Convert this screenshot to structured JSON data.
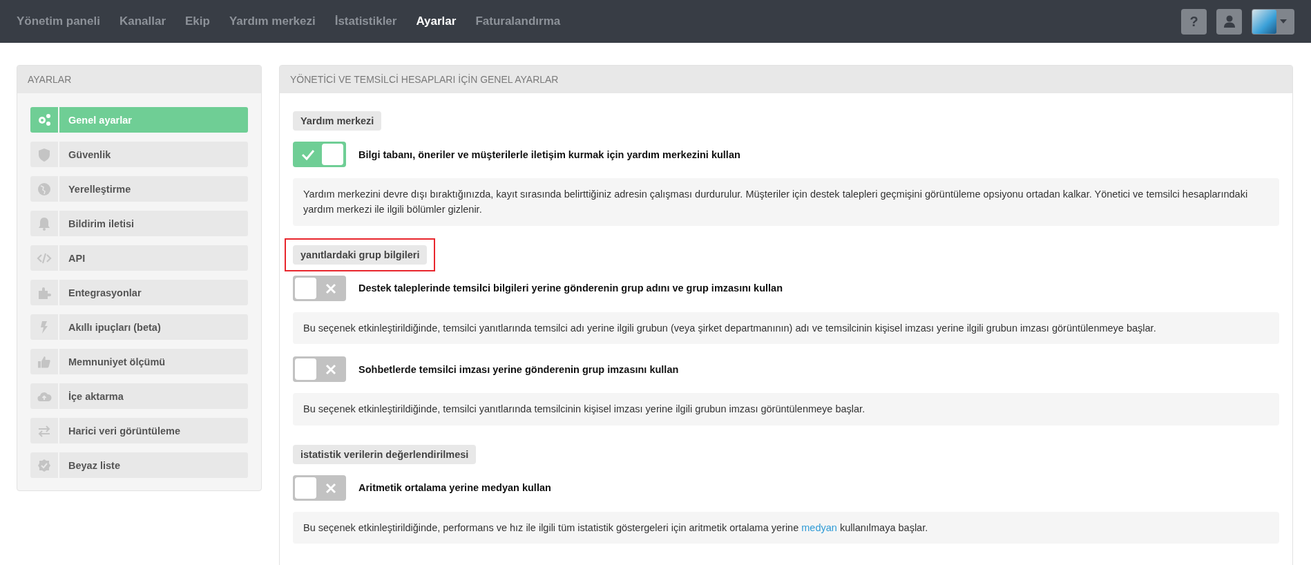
{
  "top_nav": {
    "items": [
      {
        "label": "Yönetim paneli",
        "selected": false
      },
      {
        "label": "Kanallar",
        "selected": false
      },
      {
        "label": "Ekip",
        "selected": false
      },
      {
        "label": "Yardım merkezi",
        "selected": false
      },
      {
        "label": "İstatistikler",
        "selected": false
      },
      {
        "label": "Ayarlar",
        "selected": true
      },
      {
        "label": "Faturalandırma",
        "selected": false
      }
    ],
    "help_button": "?"
  },
  "sidebar": {
    "title": "AYARLAR",
    "items": [
      {
        "label": "Genel ayarlar",
        "selected": true
      },
      {
        "label": "Güvenlik",
        "selected": false
      },
      {
        "label": "Yerelleştirme",
        "selected": false
      },
      {
        "label": "Bildirim iletisi",
        "selected": false
      },
      {
        "label": "API",
        "selected": false
      },
      {
        "label": "Entegrasyonlar",
        "selected": false
      },
      {
        "label": "Akıllı ipuçları (beta)",
        "selected": false
      },
      {
        "label": "Memnuniyet ölçümü",
        "selected": false
      },
      {
        "label": "İçe aktarma",
        "selected": false
      },
      {
        "label": "Harici veri görüntüleme",
        "selected": false
      },
      {
        "label": "Beyaz liste",
        "selected": false
      }
    ]
  },
  "main": {
    "title": "YÖNETİCİ VE TEMSİLCİ HESAPLARI İÇİN GENEL AYARLAR",
    "sections": [
      {
        "heading": "Yardım merkezi",
        "highlighted": false,
        "settings": [
          {
            "label": "Bilgi tabanı, öneriler ve müşterilerle iletişim kurmak için yardım merkezini kullan",
            "on": true,
            "description": [
              {
                "kind": "text",
                "text": "Yardım merkezini devre dışı bıraktığınızda, kayıt sırasında belirttiğiniz adresin çalışması durdurulur. Müşteriler için destek talepleri geçmişini görüntüleme opsiyonu ortadan kalkar. Yönetici ve temsilci hesaplarındaki yardım merkezi ile ilgili bölümler gizlenir."
              }
            ]
          }
        ]
      },
      {
        "heading": "yanıtlardaki grup bilgileri",
        "highlighted": true,
        "settings": [
          {
            "label": "Destek taleplerinde temsilci bilgileri yerine gönderenin grup adını ve grup imzasını kullan",
            "on": false,
            "description": [
              {
                "kind": "text",
                "text": "Bu seçenek etkinleştirildiğinde, temsilci yanıtlarında temsilci adı yerine ilgili grubun (veya şirket departmanının) adı ve temsilcinin kişisel imzası yerine ilgili grubun imzası görüntülenmeye başlar."
              }
            ]
          },
          {
            "label": "Sohbetlerde temsilci imzası yerine gönderenin grup imzasını kullan",
            "on": false,
            "description": [
              {
                "kind": "text",
                "text": "Bu seçenek etkinleştirildiğinde, temsilci yanıtlarında temsilcinin kişisel imzası yerine ilgili grubun imzası görüntülenmeye başlar."
              }
            ]
          }
        ]
      },
      {
        "heading": "istatistik verilerin değerlendirilmesi",
        "highlighted": false,
        "settings": [
          {
            "label": "Aritmetik ortalama yerine medyan kullan",
            "on": false,
            "description": [
              {
                "kind": "text",
                "text": "Bu seçenek etkinleştirildiğinde, performans ve hız ile ilgili tüm istatistik göstergeleri için aritmetik ortalama yerine "
              },
              {
                "kind": "link",
                "text": "medyan"
              },
              {
                "kind": "text",
                "text": " kullanılmaya başlar."
              }
            ]
          }
        ]
      }
    ]
  }
}
